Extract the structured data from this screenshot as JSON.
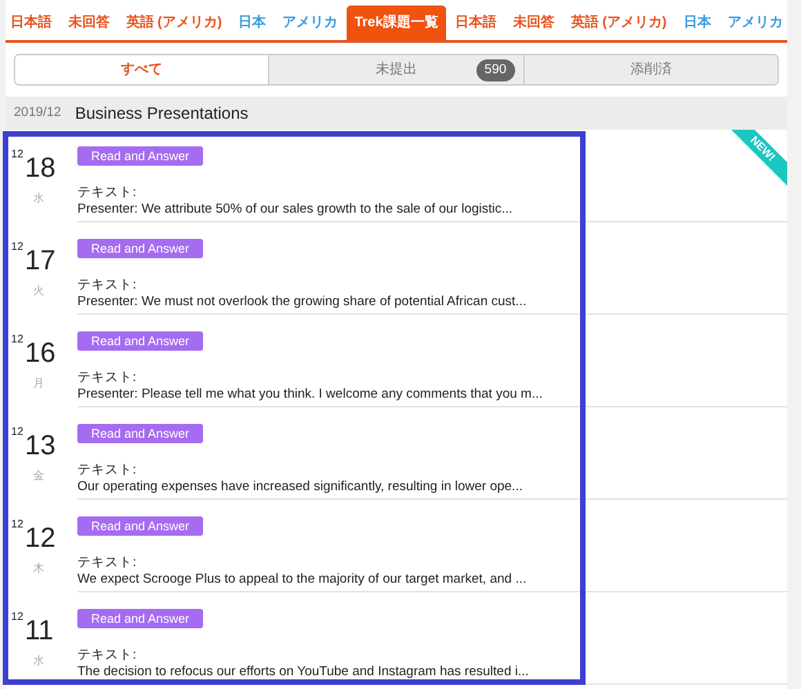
{
  "tabs": [
    {
      "label": "日本語",
      "color": "#e8531f",
      "selected": false
    },
    {
      "label": "未回答",
      "color": "#e8531f",
      "selected": false
    },
    {
      "label": "英語 (アメリカ)",
      "color": "#e8531f",
      "selected": false
    },
    {
      "label": "日本",
      "color": "#3a9be0",
      "selected": false
    },
    {
      "label": "アメリカ",
      "color": "#3a9be0",
      "selected": false
    },
    {
      "label": "Trek課題一覧",
      "selected": true
    },
    {
      "label": "日本語",
      "color": "#e8531f",
      "selected": false
    },
    {
      "label": "未回答",
      "color": "#e8531f",
      "selected": false
    },
    {
      "label": "英語 (アメリカ)",
      "color": "#e8531f",
      "selected": false
    },
    {
      "label": "日本",
      "color": "#3a9be0",
      "selected": false
    },
    {
      "label": "アメリカ",
      "color": "#3a9be0",
      "selected": false
    }
  ],
  "filters": [
    {
      "label": "すべて",
      "selected": true
    },
    {
      "label": "未提出",
      "count": "590",
      "selected": false
    },
    {
      "label": "添削済",
      "selected": false
    }
  ],
  "section": {
    "period": "2019/12",
    "title": "Business Presentations"
  },
  "highlight_frame": true,
  "items": [
    {
      "month": "12",
      "day": "18",
      "weekday": "水",
      "tag": "Read and Answer",
      "label": "テキスト:",
      "text": "Presenter: We attribute 50% of our sales growth to the sale of our logistic...",
      "new_ribbon": "NEW!"
    },
    {
      "month": "12",
      "day": "17",
      "weekday": "火",
      "tag": "Read and Answer",
      "label": "テキスト:",
      "text": "Presenter: We must not overlook the growing share of potential African cust..."
    },
    {
      "month": "12",
      "day": "16",
      "weekday": "月",
      "tag": "Read and Answer",
      "label": "テキスト:",
      "text": "Presenter: Please tell me what you think. I welcome any comments that you m..."
    },
    {
      "month": "12",
      "day": "13",
      "weekday": "金",
      "tag": "Read and Answer",
      "label": "テキスト:",
      "text": "Our operating expenses have increased significantly, resulting in lower ope..."
    },
    {
      "month": "12",
      "day": "12",
      "weekday": "木",
      "tag": "Read and Answer",
      "label": "テキスト:",
      "text": "We expect Scrooge Plus to appeal to the majority of our target market, and ..."
    },
    {
      "month": "12",
      "day": "11",
      "weekday": "水",
      "tag": "Read and Answer",
      "label": "テキスト:",
      "text": "The decision to refocus our efforts on YouTube and Instagram has resulted i..."
    }
  ]
}
